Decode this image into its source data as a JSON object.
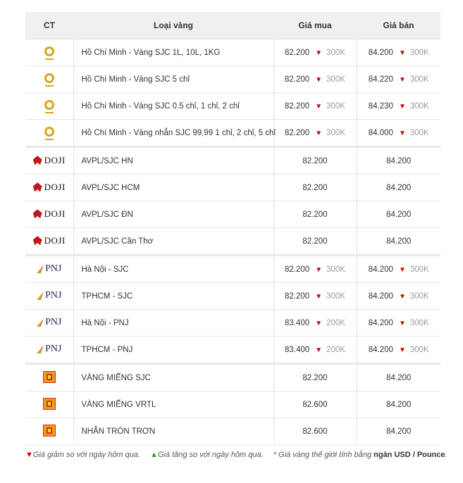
{
  "header": {
    "ct": "CT",
    "type": "Loại vàng",
    "buy": "Giá mua",
    "sell": "Giá bán"
  },
  "rows": [
    {
      "brand": "SJC",
      "name": "Hồ Chí Minh - Vàng SJC 1L, 10L, 1KG",
      "buy": "82.200",
      "buy_change": "300K",
      "sell": "84.200",
      "sell_change": "300K"
    },
    {
      "brand": "SJC",
      "name": "Hồ Chí Minh - Vàng SJC 5 chỉ",
      "buy": "82.200",
      "buy_change": "300K",
      "sell": "84.220",
      "sell_change": "300K"
    },
    {
      "brand": "SJC",
      "name": "Hồ Chí Minh - Vàng SJC 0.5 chỉ, 1 chỉ, 2 chỉ",
      "buy": "82.200",
      "buy_change": "300K",
      "sell": "84.230",
      "sell_change": "300K"
    },
    {
      "brand": "SJC",
      "name": "Hồ Chí Minh - Vàng nhẫn SJC 99,99 1 chỉ, 2 chỉ, 5 chỉ",
      "buy": "82.200",
      "buy_change": "300K",
      "sell": "84.000",
      "sell_change": "300K"
    },
    {
      "brand": "DOJI",
      "name": "AVPL/SJC HN",
      "buy": "82.200",
      "sell": "84.200"
    },
    {
      "brand": "DOJI",
      "name": "AVPL/SJC HCM",
      "buy": "82.200",
      "sell": "84.200"
    },
    {
      "brand": "DOJI",
      "name": "AVPL/SJC ĐN",
      "buy": "82.200",
      "sell": "84.200"
    },
    {
      "brand": "DOJI",
      "name": "AVPL/SJC Cần Thơ",
      "buy": "82.200",
      "sell": "84.200"
    },
    {
      "brand": "PNJ",
      "name": "Hà Nội - SJC",
      "buy": "82.200",
      "buy_change": "300K",
      "sell": "84.200",
      "sell_change": "300K"
    },
    {
      "brand": "PNJ",
      "name": "TPHCM - SJC",
      "buy": "82.200",
      "buy_change": "300K",
      "sell": "84.200",
      "sell_change": "300K"
    },
    {
      "brand": "PNJ",
      "name": "Hà Nội - PNJ",
      "buy": "83.400",
      "buy_change": "200K",
      "sell": "84.200",
      "sell_change": "300K"
    },
    {
      "brand": "PNJ",
      "name": "TPHCM - PNJ",
      "buy": "83.400",
      "buy_change": "200K",
      "sell": "84.200",
      "sell_change": "300K"
    },
    {
      "brand": "MIHONG",
      "name": "VÀNG MIẾNG SJC",
      "buy": "82.200",
      "sell": "84.200"
    },
    {
      "brand": "MIHONG",
      "name": "VÀNG MIẾNG VRTL",
      "buy": "82.600",
      "sell": "84.200"
    },
    {
      "brand": "MIHONG",
      "name": "NHẪN TRÒN TRƠN",
      "buy": "82.600",
      "sell": "84.200"
    }
  ],
  "legend": {
    "down_symbol": "▼",
    "down_text": "Giá giảm so với ngày hôm qua.",
    "up_symbol": "▲",
    "up_text": "Giá tăng so với ngày hôm qua.",
    "note_prefix": "* Giá vàng thế giới tính bằng",
    "note_bold": "ngàn USD / Pounce",
    "note_suffix": "."
  },
  "colors": {
    "down": "#cc0000",
    "up": "#2e9e2e",
    "header_bg": "#f0f0f0"
  }
}
